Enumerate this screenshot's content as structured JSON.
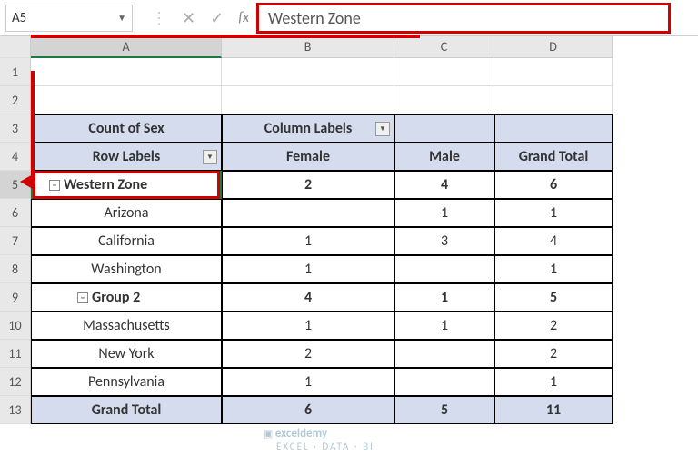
{
  "nameBox": {
    "ref": "A5"
  },
  "formulaBar": {
    "value": "Western Zone"
  },
  "columns": [
    "A",
    "B",
    "C",
    "D"
  ],
  "rows": [
    "1",
    "2",
    "3",
    "4",
    "5",
    "6",
    "7",
    "8",
    "9",
    "10",
    "11",
    "12",
    "13"
  ],
  "pivot": {
    "countLabel": "Count of Sex",
    "columnLabels": "Column Labels",
    "rowLabels": "Row Labels",
    "female": "Female",
    "male": "Male",
    "grandTotalCol": "Grand Total",
    "grandTotalRow": "Grand Total",
    "groups": [
      {
        "name": "Western Zone",
        "female": "2",
        "male": "4",
        "total": "6",
        "items": [
          {
            "name": "Arizona",
            "female": "",
            "male": "1",
            "total": "1"
          },
          {
            "name": "California",
            "female": "1",
            "male": "3",
            "total": "4"
          },
          {
            "name": "Washington",
            "female": "1",
            "male": "",
            "total": "1"
          }
        ]
      },
      {
        "name": "Group 2",
        "female": "4",
        "male": "1",
        "total": "5",
        "items": [
          {
            "name": "Massachusetts",
            "female": "1",
            "male": "1",
            "total": "2"
          },
          {
            "name": "New York",
            "female": "2",
            "male": "",
            "total": "2"
          },
          {
            "name": "Pennsylvania",
            "female": "1",
            "male": "",
            "total": "1"
          }
        ]
      }
    ],
    "totals": {
      "female": "6",
      "male": "5",
      "grand": "11"
    }
  },
  "icons": {
    "collapse": "−",
    "dropdown": "▼"
  },
  "watermark": {
    "brand": "exceldemy",
    "tagline": "EXCEL · DATA · BI"
  }
}
